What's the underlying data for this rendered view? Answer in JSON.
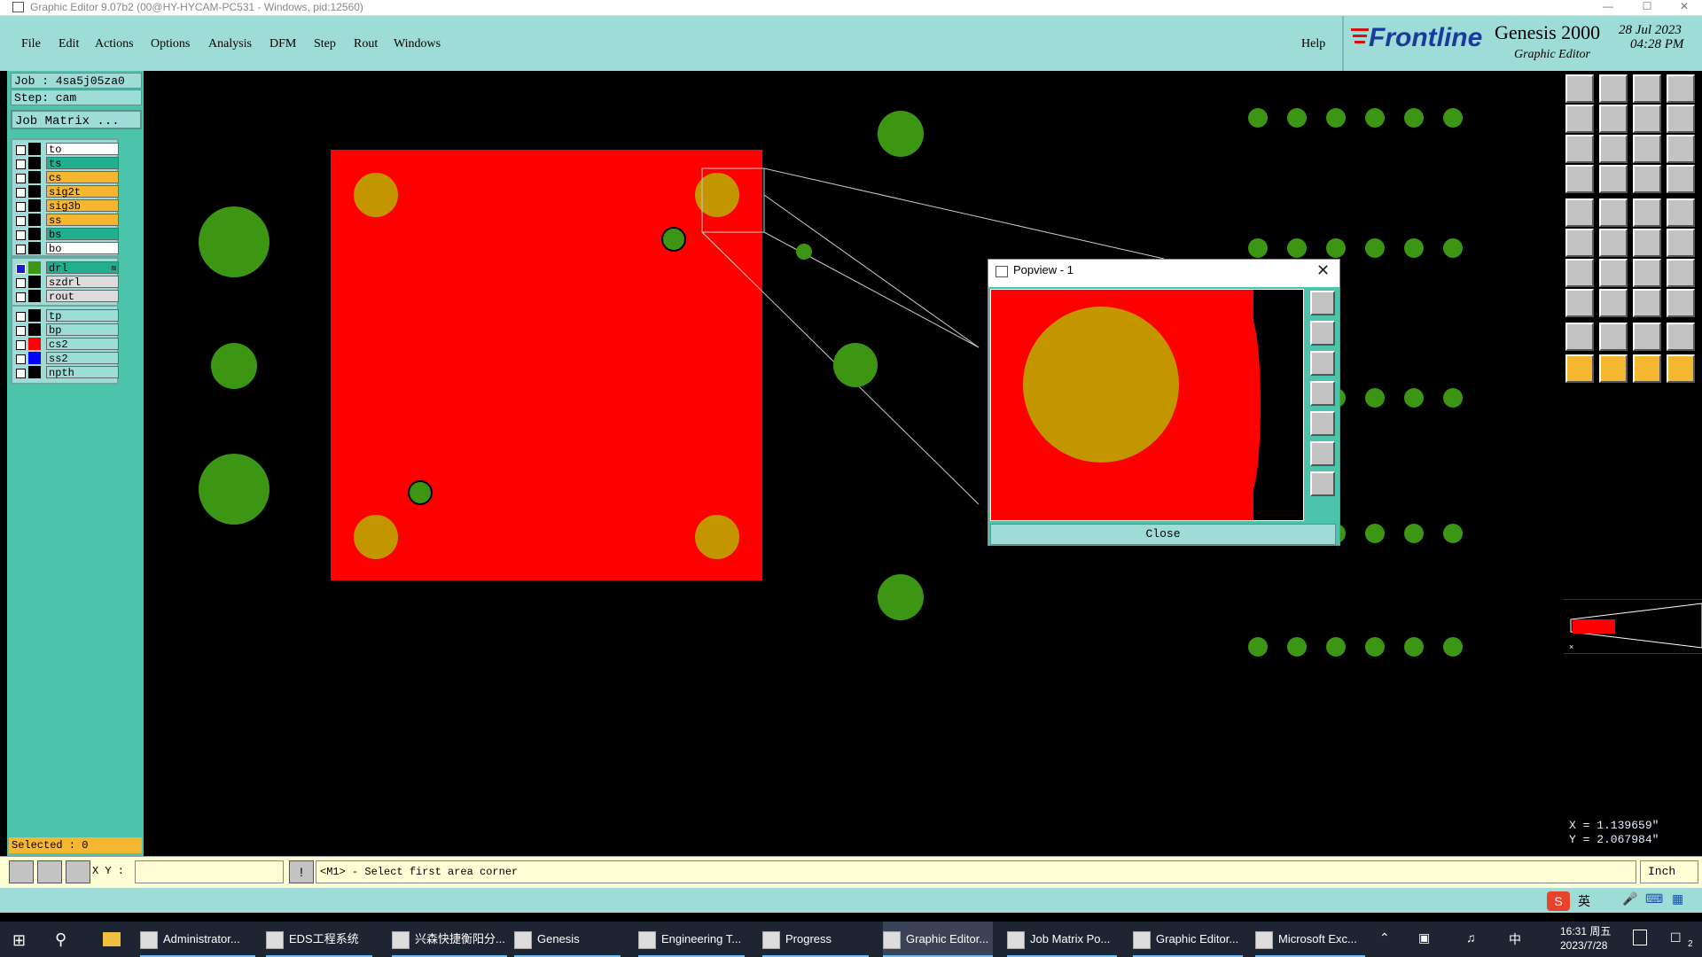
{
  "window": {
    "title": "Graphic Editor 9.07b2 (00@HY-HYCAM-PC531 - Windows, pid:12560)"
  },
  "menu": [
    "File",
    "Edit",
    "Actions",
    "Options",
    "Analysis",
    "DFM",
    "Step",
    "Rout",
    "Windows"
  ],
  "help_label": "Help",
  "brand": {
    "logo": "Frontline",
    "product": "Genesis 2000",
    "subtitle": "Graphic Editor",
    "date": "28 Jul 2023",
    "time": "04:28 PM"
  },
  "job": {
    "job_label": "Job : 4sa5j05za0",
    "step_label": "Step: cam",
    "matrix_button": "Job Matrix ..."
  },
  "layer_groups": [
    {
      "layers": [
        {
          "name": "to",
          "bg": "#ffffff"
        },
        {
          "name": "ts",
          "bg": "#20b090"
        },
        {
          "name": "cs",
          "bg": "#f5b730"
        },
        {
          "name": "sig2t",
          "bg": "#f5b730"
        },
        {
          "name": "sig3b",
          "bg": "#f5b730"
        },
        {
          "name": "ss",
          "bg": "#f5b730"
        },
        {
          "name": "bs",
          "bg": "#20b090"
        },
        {
          "name": "bo",
          "bg": "#ffffff"
        }
      ]
    },
    {
      "layers": [
        {
          "name": "drl",
          "bg": "#20b090",
          "swatch": "#3c9614",
          "checked_blue": true,
          "mark": "m"
        },
        {
          "name": "szdrl",
          "bg": "#dcdcdc"
        },
        {
          "name": "rout",
          "bg": "#dcdcdc"
        }
      ]
    },
    {
      "layers": [
        {
          "name": "tp",
          "bg": "#9ddcd7"
        },
        {
          "name": "bp",
          "bg": "#9ddcd7"
        },
        {
          "name": "cs2",
          "bg": "#9ddcd7",
          "swatch": "#ff0000"
        },
        {
          "name": "ss2",
          "bg": "#9ddcd7",
          "swatch": "#0000ff"
        },
        {
          "name": "npth",
          "bg": "#9ddcd7"
        }
      ]
    }
  ],
  "selected_label": "Selected : 0",
  "status": {
    "xy_label": "X Y :",
    "xy_value": "",
    "info_glyph": "!",
    "message": "<M1> - Select first area corner",
    "units": "Inch"
  },
  "coords": {
    "x": "X = 1.139659\"",
    "y": "Y = 2.067984\""
  },
  "popview": {
    "title": "Popview - 1",
    "close_label": "Close"
  },
  "colors": {
    "board_fill": "#ff0000",
    "pad": "#c39600",
    "drill": "#3c9614",
    "panel": "#9ddcd7",
    "panel_dark": "#4bc4ab"
  },
  "taskbar": {
    "items": [
      {
        "label": "Administrator..."
      },
      {
        "label": "EDS工程系统"
      },
      {
        "label": "兴森快捷衡阳分..."
      },
      {
        "label": "Genesis"
      },
      {
        "label": "Engineering T..."
      },
      {
        "label": "Progress"
      },
      {
        "label": "Graphic Editor...",
        "active": true
      },
      {
        "label": "Job Matrix Po..."
      },
      {
        "label": "Graphic Editor..."
      },
      {
        "label": "Microsoft Exc..."
      }
    ],
    "ime_lang": "英",
    "ime_cn": "中",
    "clock_time": "16:31 周五",
    "clock_date": "2023/7/28",
    "notif_count": "2"
  }
}
